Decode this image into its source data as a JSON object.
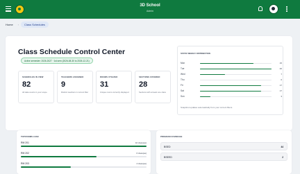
{
  "app": {
    "title": "3D School",
    "subtitle": "Admin"
  },
  "breadcrumb": {
    "home": "Home",
    "current": "Class Schedules"
  },
  "hero": {
    "title": "Class Schedule Control Center",
    "semester": "Active semester: 2026-2027 · 1st sem (2026-08-30 to 2026-12-21)"
  },
  "stats": [
    {
      "label": "SCHEDULES IN VIEW",
      "value": "82",
      "desc": "All data counts in your scope"
    },
    {
      "label": "TEACHERS ASSIGNED",
      "value": "9",
      "desc": "Distinct teachers in current filter"
    },
    {
      "label": "ROOMS UTILIZED",
      "value": "31",
      "desc": "Unique rooms currently displayed"
    },
    {
      "label": "SECTIONS COVERED",
      "value": "28",
      "desc": "Sections with at least one class"
    }
  ],
  "distribution": {
    "title": "STATIC WEEKLY DISTRIBUTION",
    "max": 20,
    "days": [
      {
        "day": "Mon",
        "count": 15
      },
      {
        "day": "Tue",
        "count": 20
      },
      {
        "day": "Wed",
        "count": 7
      },
      {
        "day": "Thu",
        "count": 0
      },
      {
        "day": "Fri",
        "count": 17
      },
      {
        "day": "Sat",
        "count": 17
      },
      {
        "day": "Sun",
        "count": 3
      }
    ],
    "note": "Snapshot updates automatically from your current filters."
  },
  "rooms": {
    "title": "TOP ROOMS LOAD",
    "items": [
      {
        "name": "RM 201",
        "value": "10 class(es)",
        "level": 1.0
      },
      {
        "name": "RM 202",
        "value": "6 class(es)",
        "level": 0.6
      },
      {
        "name": "RM 203",
        "value": "4 class(es)",
        "level": 0.4
      }
    ]
  },
  "programs": {
    "title": "PROGRAM COVERAGE",
    "items": [
      {
        "name": "BSED",
        "count": "44"
      },
      {
        "name": "BSEED",
        "count": "2"
      }
    ]
  },
  "colors": {
    "brand": "#0f7a3f",
    "accent": "#f2c811"
  }
}
